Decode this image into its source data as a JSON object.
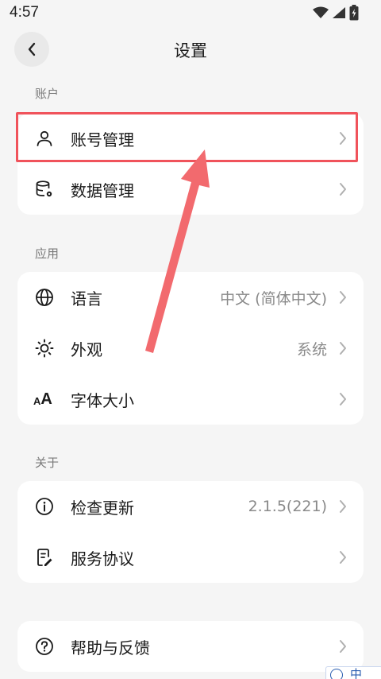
{
  "status_bar": {
    "time": "4:57"
  },
  "header": {
    "title": "设置"
  },
  "sections": {
    "account": {
      "label": "账户",
      "items": [
        {
          "label": "账号管理",
          "icon": "user-icon"
        },
        {
          "label": "数据管理",
          "icon": "database-icon"
        }
      ]
    },
    "application": {
      "label": "应用",
      "items": [
        {
          "label": "语言",
          "value": "中文 (简体中文)",
          "icon": "globe-icon"
        },
        {
          "label": "外观",
          "value": "系统",
          "icon": "sun-icon"
        },
        {
          "label": "字体大小",
          "icon": "font-size-icon",
          "icon_text": "AA"
        }
      ]
    },
    "about": {
      "label": "关于",
      "items": [
        {
          "label": "检查更新",
          "value": "2.1.5(221)",
          "icon": "info-icon"
        },
        {
          "label": "服务协议",
          "icon": "document-edit-icon"
        }
      ]
    },
    "help": {
      "items": [
        {
          "label": "帮助与反馈",
          "icon": "question-icon"
        }
      ]
    }
  },
  "ime_indicator": {
    "char": "中"
  },
  "colors": {
    "highlight": "#f0535b",
    "background": "#f5f5f5",
    "card": "#ffffff"
  }
}
